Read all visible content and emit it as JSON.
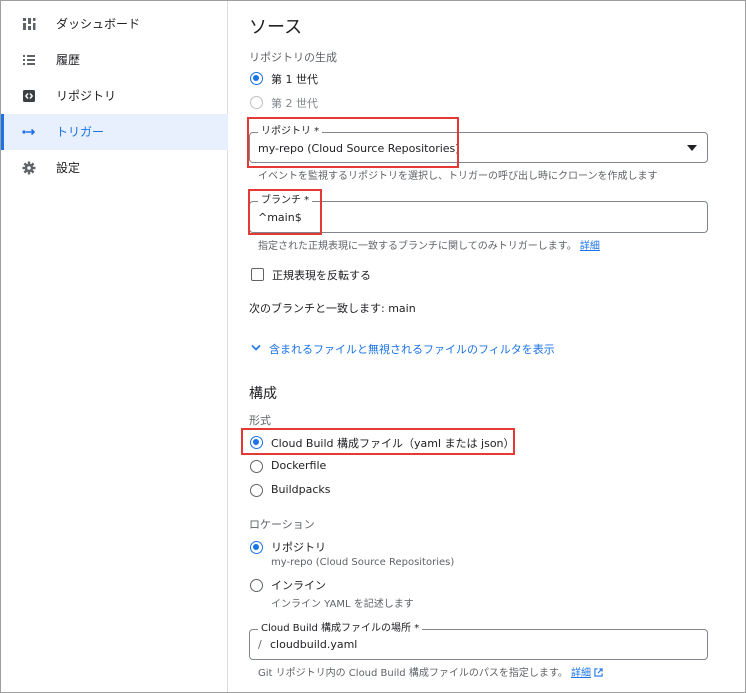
{
  "sidebar": {
    "items": [
      {
        "label": "ダッシュボード",
        "icon": "dashboard-icon"
      },
      {
        "label": "履歴",
        "icon": "history-list-icon"
      },
      {
        "label": "リポジトリ",
        "icon": "repository-icon"
      },
      {
        "label": "トリガー",
        "icon": "trigger-arrow-icon",
        "active": true
      },
      {
        "label": "設定",
        "icon": "gear-icon"
      }
    ]
  },
  "source": {
    "title": "ソース",
    "generation_label": "リポジトリの生成",
    "gen1": "第 1 世代",
    "gen2": "第 2 世代",
    "repo_field_label": "リポジトリ *",
    "repo_value": "my-repo (Cloud Source Repositories)",
    "repo_help": "イベントを監視するリポジトリを選択し、トリガーの呼び出し時にクローンを作成します",
    "branch_field_label": "ブランチ *",
    "branch_value": "^main$",
    "branch_help": "指定された正規表現に一致するブランチに関してのみトリガーします。",
    "branch_help_link": "詳細",
    "invert_regex": "正規表現を反転する",
    "matches_text": "次のブランチと一致します: main",
    "filter_toggle": "含まれるファイルと無視されるファイルのフィルタを表示"
  },
  "config": {
    "title": "構成",
    "format_label": "形式",
    "opt_cloudbuild": "Cloud Build 構成ファイル（yaml または json）",
    "opt_dockerfile": "Dockerfile",
    "opt_buildpacks": "Buildpacks",
    "location_label": "ロケーション",
    "loc_repo": "リポジトリ",
    "loc_repo_sub": "my-repo (Cloud Source Repositories)",
    "loc_inline": "インライン",
    "loc_inline_sub": "インライン YAML を記述します",
    "file_field_label": "Cloud Build 構成ファイルの場所 *",
    "file_prefix": "/",
    "file_value": "cloudbuild.yaml",
    "file_help": "Git リポジトリ内の Cloud Build 構成ファイルのパスを指定します。",
    "file_help_link": "詳細"
  },
  "colors": {
    "accent": "#1a73e8",
    "highlight": "#e53935"
  }
}
